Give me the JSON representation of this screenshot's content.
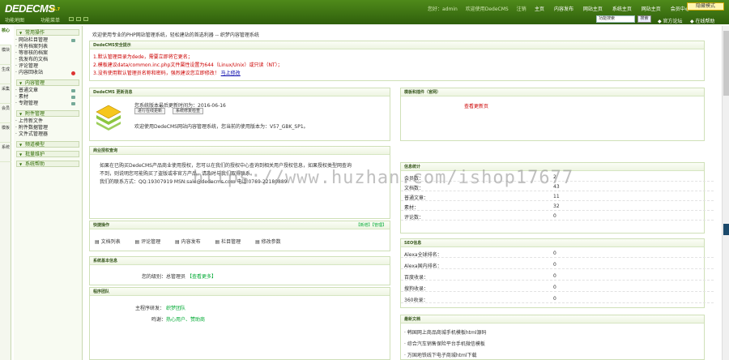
{
  "header": {
    "logo": "DEDECMS",
    "version": "v5.7",
    "user_links": [
      "您好：admin",
      "欢迎使用DedeCMS",
      "注销"
    ],
    "nav": [
      "主页",
      "内容发布",
      "网站主页",
      "系统主页",
      "网站主页",
      "会员中心"
    ],
    "mode_button": "隐藏模式",
    "sub_links": [
      "功能地图",
      "功能菜单"
    ],
    "search_value": "功能搜索",
    "search_button": "搜索",
    "right_links": [
      "官方论坛",
      "在线帮助"
    ]
  },
  "sidebar_tabs": [
    "核心",
    "模块",
    "生成",
    "采集",
    "会员",
    "模板",
    "系统"
  ],
  "menu": {
    "groups": [
      {
        "title": "常用操作",
        "items": [
          {
            "label": "网站栏目管理",
            "icon": "grid"
          },
          {
            "label": "所有档案列表",
            "icon": ""
          },
          {
            "label": "等审核的档案",
            "icon": ""
          },
          {
            "label": "我发布的文档",
            "icon": ""
          },
          {
            "label": "评论管理",
            "icon": ""
          },
          {
            "label": "内容回收站",
            "icon": "red"
          }
        ]
      },
      {
        "title": "内容管理",
        "items": [
          {
            "label": "普通文章",
            "icon": "grid"
          },
          {
            "label": "素材",
            "icon": "grid"
          },
          {
            "label": "专题管理",
            "icon": "grid"
          }
        ]
      },
      {
        "title": "附件管理",
        "items": [
          {
            "label": "上传新文件",
            "icon": ""
          },
          {
            "label": "附件数据管理",
            "icon": ""
          },
          {
            "label": "文件式管理器",
            "icon": ""
          }
        ]
      },
      {
        "title": "频道模型",
        "items": []
      },
      {
        "title": "批量维护",
        "items": []
      },
      {
        "title": "系统帮助",
        "items": []
      }
    ]
  },
  "breadcrumb": "欢迎使用专业的PHP网站管理系统，轻松建站的首选利器 -- 织梦内容管理系统",
  "security": {
    "title": "DedeCMS安全提示",
    "lines": [
      "1.默认管理目录为dede，需要立即将它更名；",
      "2.模板建议data/common.inc.php文件属性设置为644（Linux/Unix）或只读（NT）；",
      "3.没有使用默认管理员名称和密码，强烈建议您立即修改！"
    ],
    "line3_link": "马上修改"
  },
  "update": {
    "title": "DedeCMS 更新消息",
    "last_update": "您系统版本最后更新时间为：2016-06-16",
    "buttons": [
      "进行在线更新",
      "系统修复检查"
    ],
    "version_text": "欢迎使用DedeCMS网站内容管理系统，您当前的使用版本为：V57_GBK_SP1。"
  },
  "auth": {
    "title": "商业授权查询",
    "lines": [
      "如果在已购买DedeCMS产品商业使用授权，您可以在我们的授权中心查询到相关用户授权信息，如果授权类型网查询",
      "不到，则说明您可能购买了盗版或非官方产品，请及时与我们取得联系。",
      "我们的联系方式：QQ:19307919 MSN:sale@dedecms.com 电话:0769-22180889"
    ]
  },
  "quick": {
    "title": "快捷操作",
    "right_link": "【新增】【管理】",
    "links": [
      "文档列表",
      "评论管理",
      "内容发布",
      "栏目管理",
      "修改参数"
    ]
  },
  "sysinfo": {
    "title": "系统基本信息",
    "label": "您的级别：",
    "value": "总管理员",
    "link": "【查看更多】"
  },
  "team": {
    "title": "程序团队",
    "label1": "主程序研发：",
    "value1": "织梦团队",
    "label2": "鸣谢：",
    "value2": "热心用户、赞助商"
  },
  "official": {
    "title": "模板和插件（官网）",
    "text": "查看更新页"
  },
  "stats": {
    "title": "信息统计",
    "rows": [
      {
        "label": "会员数：",
        "value": "2"
      },
      {
        "label": "文档数：",
        "value": "43"
      },
      {
        "label": "普通文章：",
        "value": "11"
      },
      {
        "label": "素材：",
        "value": "32"
      },
      {
        "label": "评论数：",
        "value": "0"
      }
    ]
  },
  "seo": {
    "title": "SEO信息",
    "rows": [
      {
        "label": "Alexa全球排名：",
        "value": "0"
      },
      {
        "label": "Alexa国内排名：",
        "value": "0"
      },
      {
        "label": "百度收录：",
        "value": "0"
      },
      {
        "label": "搜狗收录：",
        "value": "0"
      },
      {
        "label": "360收录：",
        "value": "0"
      }
    ]
  },
  "latest": {
    "title": "最新文档",
    "items": [
      "韩国网上商品商城手机模板html源码",
      "综合汽车销售保险平台手机微信模板",
      "万国地铁线下电子商城html下载"
    ]
  },
  "watermark": "https://www.huzhan.com/ishop17677",
  "colors": {
    "brand": "#3c7214",
    "link": "#00aa33",
    "warning": "#cc0000"
  }
}
